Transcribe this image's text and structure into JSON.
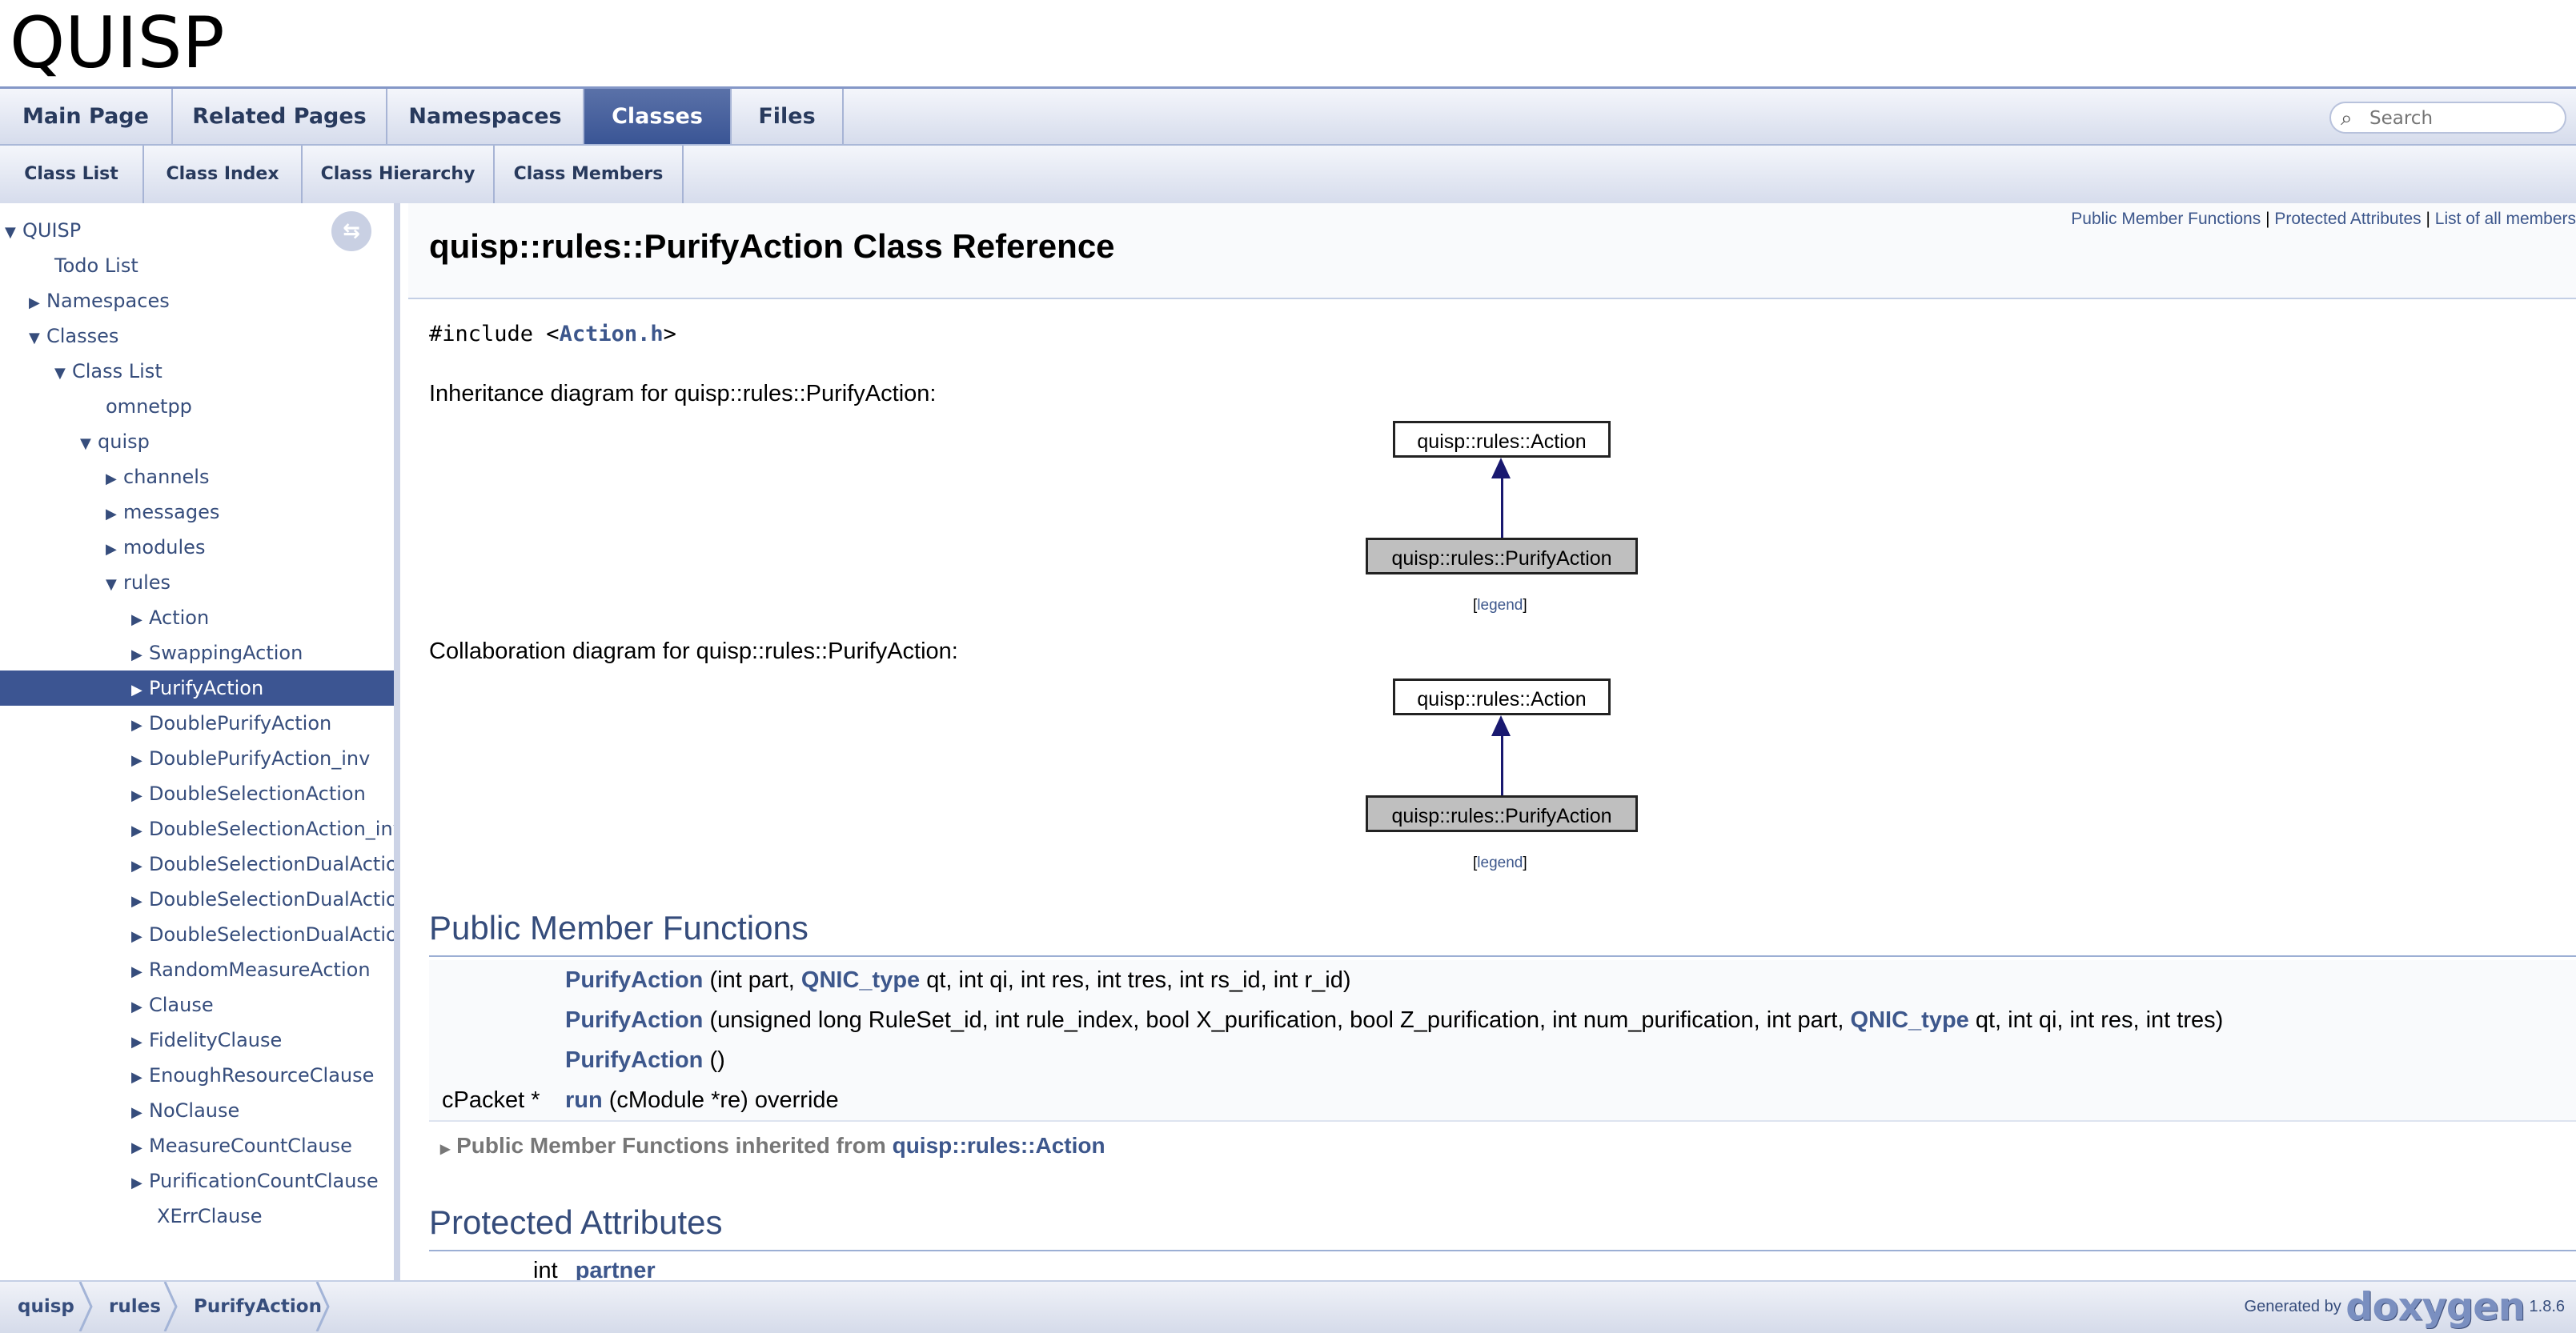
{
  "project": {
    "name": "QUISP"
  },
  "tabs": [
    {
      "label": "Main Page"
    },
    {
      "label": "Related Pages"
    },
    {
      "label": "Namespaces"
    },
    {
      "label": "Classes"
    },
    {
      "label": "Files"
    }
  ],
  "search": {
    "placeholder": "Search"
  },
  "subtabs": [
    {
      "label": "Class List"
    },
    {
      "label": "Class Index"
    },
    {
      "label": "Class Hierarchy"
    },
    {
      "label": "Class Members"
    }
  ],
  "nav": {
    "items": [
      {
        "label": "QUISP"
      },
      {
        "label": "Todo List"
      },
      {
        "label": "Namespaces"
      },
      {
        "label": "Classes"
      },
      {
        "label": "Class List"
      },
      {
        "label": "omnetpp"
      },
      {
        "label": "quisp"
      },
      {
        "label": "channels"
      },
      {
        "label": "messages"
      },
      {
        "label": "modules"
      },
      {
        "label": "rules"
      },
      {
        "label": "Action"
      },
      {
        "label": "SwappingAction"
      },
      {
        "label": "PurifyAction"
      },
      {
        "label": "DoublePurifyAction"
      },
      {
        "label": "DoublePurifyAction_inv"
      },
      {
        "label": "DoubleSelectionAction"
      },
      {
        "label": "DoubleSelectionAction_inv"
      },
      {
        "label": "DoubleSelectionDualAction"
      },
      {
        "label": "DoubleSelectionDualAction"
      },
      {
        "label": "DoubleSelectionDualAction"
      },
      {
        "label": "RandomMeasureAction"
      },
      {
        "label": "Clause"
      },
      {
        "label": "FidelityClause"
      },
      {
        "label": "EnoughResourceClause"
      },
      {
        "label": "NoClause"
      },
      {
        "label": "MeasureCountClause"
      },
      {
        "label": "PurificationCountClause"
      },
      {
        "label": "XErrClause"
      }
    ]
  },
  "summary": {
    "public_member_functions": "Public Member Functions",
    "sep1": " | ",
    "protected_attributes": "Protected Attributes",
    "sep2": " | ",
    "list_all_members": "List of all members"
  },
  "page": {
    "title": "quisp::rules::PurifyAction Class Reference",
    "include_prefix": "#include <",
    "include_file": "Action.h",
    "include_suffix": ">",
    "inheritance_caption": "Inheritance diagram for quisp::rules::PurifyAction:",
    "collaboration_caption": "Collaboration diagram for quisp::rules::PurifyAction:"
  },
  "diagram": {
    "parent": "quisp::rules::Action",
    "child": "quisp::rules::PurifyAction",
    "legend_open": "[",
    "legend": "legend",
    "legend_close": "]"
  },
  "public_functions": {
    "heading": "Public Member Functions",
    "rows": [
      {
        "type": "",
        "name": "PurifyAction",
        "args_a": " (int part, ",
        "link": "QNIC_type",
        "args_b": " qt, int qi, int res, int tres, int rs_id, int r_id)"
      },
      {
        "type": "",
        "name": "PurifyAction",
        "args_a": " (unsigned long RuleSet_id, int rule_index, bool X_purification, bool Z_purification, int num_purification, int part, ",
        "link": "QNIC_type",
        "args_b": " qt, int qi, int res, int tres)"
      },
      {
        "type": "",
        "name": "PurifyAction",
        "args_a": " ()",
        "link": "",
        "args_b": ""
      },
      {
        "type": "cPacket *",
        "name": "run",
        "args_a": " (cModule *re) override",
        "link": "",
        "args_b": ""
      }
    ],
    "inherited_label": "Public Member Functions inherited from ",
    "inherited_link": "quisp::rules::Action"
  },
  "protected_attributes": {
    "heading": "Protected Attributes",
    "first_type": "int",
    "first_name": "partner"
  },
  "breadcrumb": [
    {
      "label": "quisp"
    },
    {
      "label": "rules"
    },
    {
      "label": "PurifyAction"
    }
  ],
  "footer": {
    "generated_by": "Generated by",
    "logo": "doxygen",
    "version": "1.8.6"
  }
}
